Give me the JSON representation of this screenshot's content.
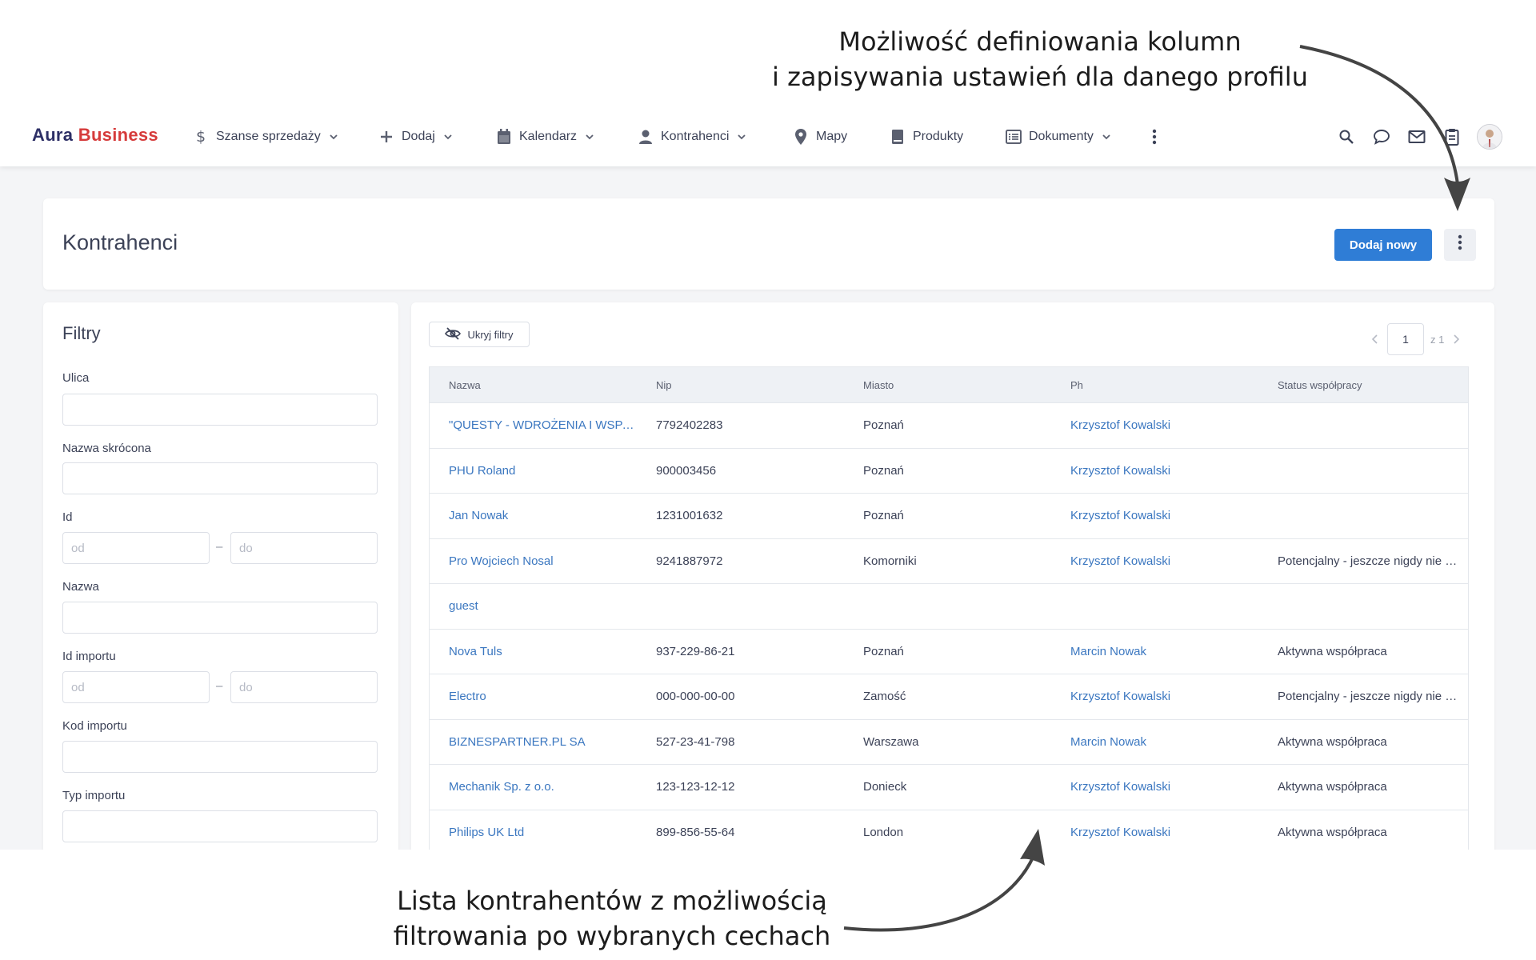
{
  "callouts": {
    "top_line1": "Możliwość definiowania kolumn",
    "top_line2": "i zapisywania ustawień dla danego profilu",
    "bottom_line1": "Lista kontrahentów z możliwością",
    "bottom_line2": "filtrowania po wybranych cechach"
  },
  "brand": {
    "part1": "Aura",
    "part2": "Business"
  },
  "nav": [
    {
      "label": "Szanse sprzedaży",
      "icon": "dollar-icon",
      "dropdown": true
    },
    {
      "label": "Dodaj",
      "icon": "plus-icon",
      "dropdown": true
    },
    {
      "label": "Kalendarz",
      "icon": "calendar-icon",
      "dropdown": true
    },
    {
      "label": "Kontrahenci",
      "icon": "user-icon",
      "dropdown": true
    },
    {
      "label": "Mapy",
      "icon": "map-pin-icon",
      "dropdown": false
    },
    {
      "label": "Produkty",
      "icon": "book-icon",
      "dropdown": false
    },
    {
      "label": "Dokumenty",
      "icon": "list-icon",
      "dropdown": true
    }
  ],
  "page": {
    "title": "Kontrahenci",
    "add_button": "Dodaj nowy"
  },
  "filters": {
    "title": "Filtry",
    "ulica": "Ulica",
    "nazwa_skrocona": "Nazwa skrócona",
    "id": "Id",
    "nazwa": "Nazwa",
    "id_importu": "Id importu",
    "kod_importu": "Kod importu",
    "typ_importu": "Typ importu",
    "ph_from": "od",
    "ph_to": "do",
    "range_sep": "–"
  },
  "list": {
    "hide_filters": "Ukryj filtry",
    "pager": {
      "current": "1",
      "of": "z 1"
    },
    "columns": [
      "Nazwa",
      "Nip",
      "Miasto",
      "Ph",
      "Status współpracy"
    ],
    "rows": [
      [
        "\"QUESTY - WDROŻENIA I WSPARCIE",
        "7792402283",
        "Poznań",
        "Krzysztof Kowalski",
        ""
      ],
      [
        "PHU Roland",
        "900003456",
        "Poznań",
        "Krzysztof Kowalski",
        ""
      ],
      [
        "Jan Nowak",
        "1231001632",
        "Poznań",
        "Krzysztof Kowalski",
        ""
      ],
      [
        "Pro Wojciech Nosal",
        "9241887972",
        "Komorniki",
        "Krzysztof Kowalski",
        "Potencjalny - jeszcze nigdy nie kupował"
      ],
      [
        "guest",
        "",
        "",
        "",
        ""
      ],
      [
        "Nova Tuls",
        "937-229-86-21",
        "Poznań",
        "Marcin Nowak",
        "Aktywna współpraca"
      ],
      [
        "Electro",
        "000-000-00-00",
        "Zamość",
        "Krzysztof Kowalski",
        "Potencjalny - jeszcze nigdy nie kupował"
      ],
      [
        "BIZNESPARTNER.PL SA",
        "527-23-41-798",
        "Warszawa",
        "Marcin Nowak",
        "Aktywna współpraca"
      ],
      [
        "Mechanik Sp. z o.o.",
        "123-123-12-12",
        "Donieck",
        "Krzysztof Kowalski",
        "Aktywna współpraca"
      ],
      [
        "Philips UK Ltd",
        "899-856-55-64",
        "London",
        "Krzysztof Kowalski",
        "Aktywna współpraca"
      ]
    ]
  },
  "colors": {
    "primary": "#2f7dd6",
    "link": "#3b77c0",
    "brand_dark": "#2d2f66",
    "brand_red": "#d63b3b"
  }
}
